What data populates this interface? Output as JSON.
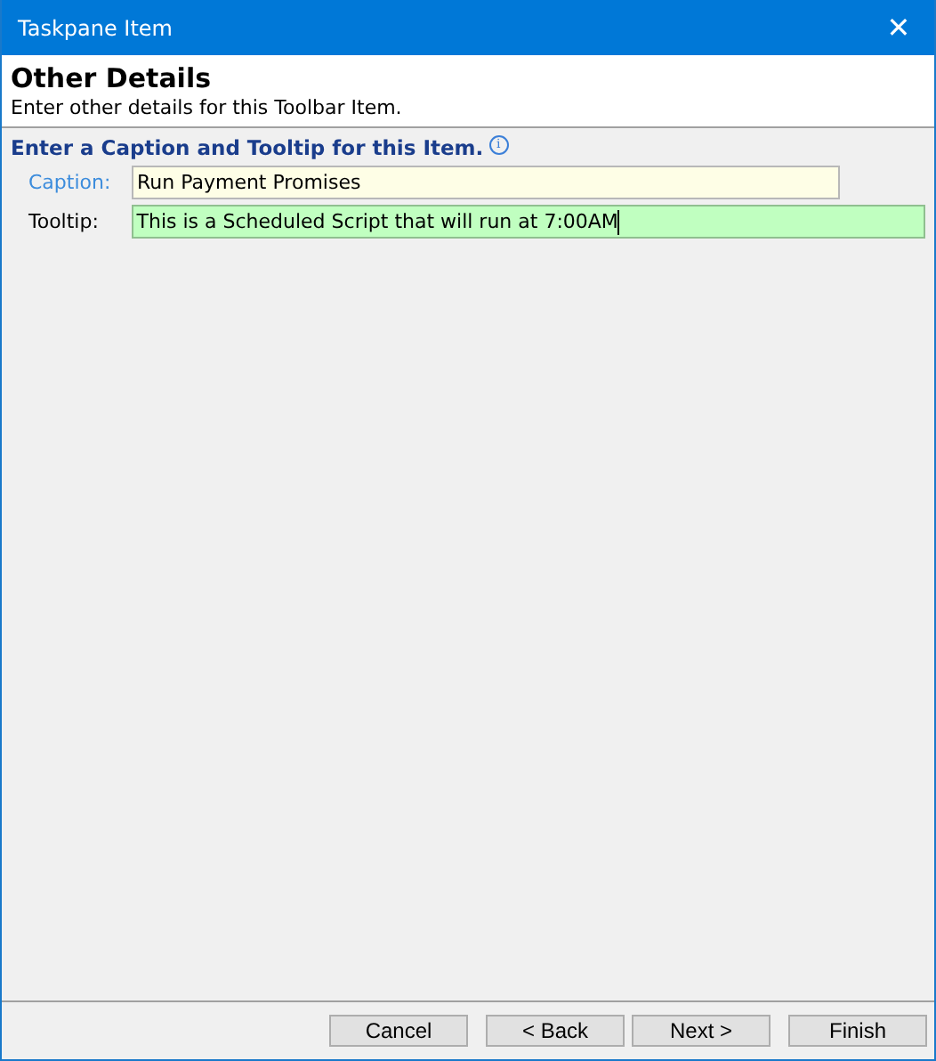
{
  "window": {
    "title": "Taskpane Item",
    "close": "✕"
  },
  "header": {
    "title": "Other Details",
    "subtitle": "Enter other details for this Toolbar Item."
  },
  "section": {
    "title": "Enter a Caption and Tooltip for this Item.",
    "info": "i"
  },
  "fields": [
    {
      "label": "Caption:",
      "value": "Run Payment Promises",
      "label_highlighted": true,
      "focused": false
    },
    {
      "label": "Tooltip:",
      "value": "This is a Scheduled Script that will run at 7:00AM",
      "label_highlighted": false,
      "focused": true
    }
  ],
  "buttons": [
    "Cancel",
    "< Back",
    "Next >",
    "Finish"
  ]
}
